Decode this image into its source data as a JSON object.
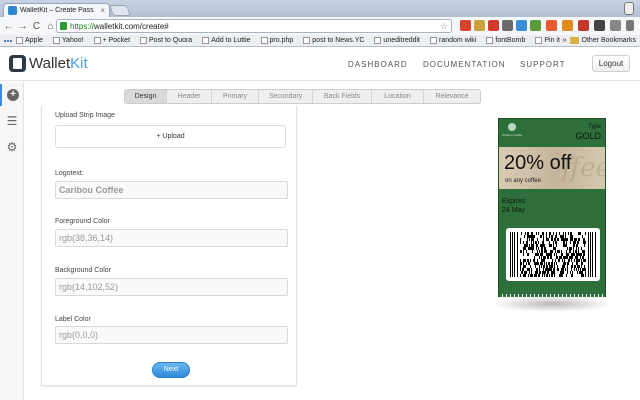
{
  "browser": {
    "tab_title": "WalletKit – Create Pass",
    "tab_close": "×",
    "url_scheme": "https://",
    "url_rest": "walletkit.com/create#",
    "nav": {
      "back": "←",
      "forward": "→",
      "reload": "C",
      "home": "⌂"
    },
    "bookmarks": [
      "Apple",
      "Yahoo!",
      "+ Pocket",
      "Post to Quora",
      "Add to Luttie",
      "pro.php",
      "post to News.YC",
      "uneditreddit",
      "random wiki",
      "fontBomb",
      "Pin it"
    ],
    "other_bookmarks": "Other Bookmarks",
    "bookmark_chevron": "»"
  },
  "app": {
    "logo_wallet": "Wallet",
    "logo_kit": "Kit",
    "nav": [
      "DASHBOARD",
      "DOCUMENTATION",
      "SUPPORT"
    ],
    "logout": "Logout"
  },
  "rail": {
    "icons": [
      "add-icon",
      "menu-icon",
      "gear-icon"
    ],
    "plus": "+",
    "menu": "☰",
    "gear": "⚙"
  },
  "tabs": [
    {
      "label": "Design",
      "active": true
    },
    {
      "label": "Header",
      "active": false
    },
    {
      "label": "Primary",
      "active": false
    },
    {
      "label": "Secondary",
      "active": false
    },
    {
      "label": "Back Fields",
      "active": false
    },
    {
      "label": "Location",
      "active": false
    },
    {
      "label": "Relevance",
      "active": false
    }
  ],
  "form": {
    "upload_strip_label": "Upload Strip Image",
    "upload_button": "+ Upload",
    "logotext_label": "Logotext:",
    "logotext_value": "Caribou Coffee",
    "foreground_label": "Foreground Color",
    "foreground_value": "rgb(38,36,14)",
    "background_label": "Background Color",
    "background_value": "rgb(14,102,52)",
    "label_color_label": "Label Color",
    "label_color_value": "rgb(0,0,0)",
    "next_button": "Next"
  },
  "pass": {
    "logo_text": "Caribou Coffee",
    "type_label": "Type",
    "type_value": "GOLD",
    "primary_value": "20% off",
    "primary_label": "on any coffee",
    "expires_label": "Expires",
    "expires_value": "24 May",
    "background_color": "#2e6e3a"
  },
  "colors": {
    "accent": "#3a8fd8",
    "next_button": "#2f8ad9"
  }
}
